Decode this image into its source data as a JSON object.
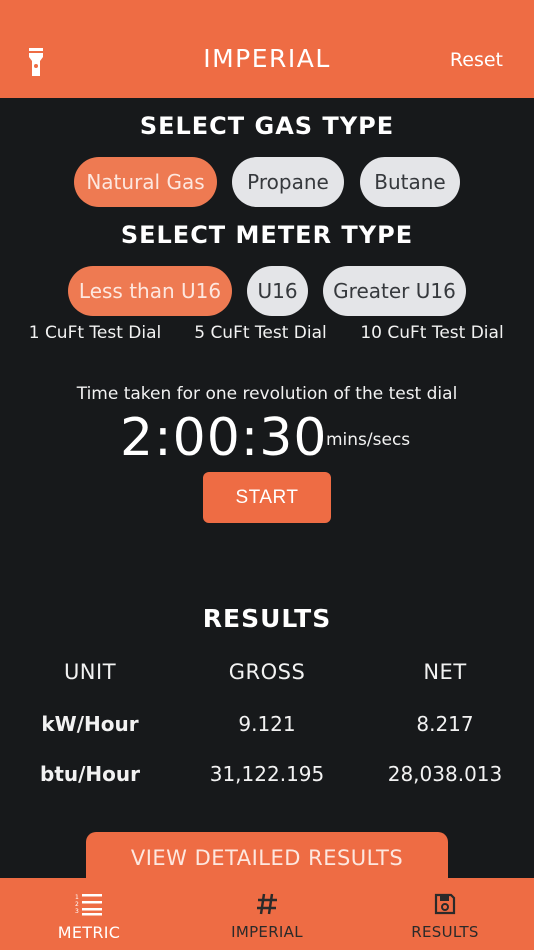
{
  "header": {
    "title": "IMPERIAL",
    "reset_label": "Reset",
    "torch_icon": "flashlight-icon"
  },
  "gas_type": {
    "title": "SELECT GAS TYPE",
    "options": [
      {
        "label": "Natural Gas",
        "selected": true
      },
      {
        "label": "Propane",
        "selected": false
      },
      {
        "label": "Butane",
        "selected": false
      }
    ]
  },
  "meter_type": {
    "title": "SELECT METER TYPE",
    "options": [
      {
        "label": "Less than U16",
        "selected": true,
        "dial": "1 CuFt Test Dial"
      },
      {
        "label": "U16",
        "selected": false,
        "dial": "5 CuFt Test Dial"
      },
      {
        "label": "Greater U16",
        "selected": false,
        "dial": "10 CuFt Test Dial"
      }
    ]
  },
  "timer": {
    "caption": "Time taken for one revolution of the test dial",
    "value": "2:00:30",
    "unit": "mins/secs",
    "start_label": "START"
  },
  "results": {
    "title": "RESULTS",
    "headers": [
      "UNIT",
      "GROSS",
      "NET"
    ],
    "rows": [
      [
        "kW/Hour",
        "9.121",
        "8.217"
      ],
      [
        "btu/Hour",
        "31,122.195",
        "28,038.013"
      ]
    ],
    "detail_label": "VIEW DETAILED RESULTS"
  },
  "tabs": [
    {
      "label": "METRIC",
      "icon": "numbered-list-icon",
      "active": true
    },
    {
      "label": "IMPERIAL",
      "icon": "hash-icon",
      "active": false
    },
    {
      "label": "RESULTS",
      "icon": "save-icon",
      "active": false
    }
  ],
  "colors": {
    "accent": "#ee6c44",
    "background": "#17191b",
    "pill_inactive": "#e4e5e8"
  }
}
